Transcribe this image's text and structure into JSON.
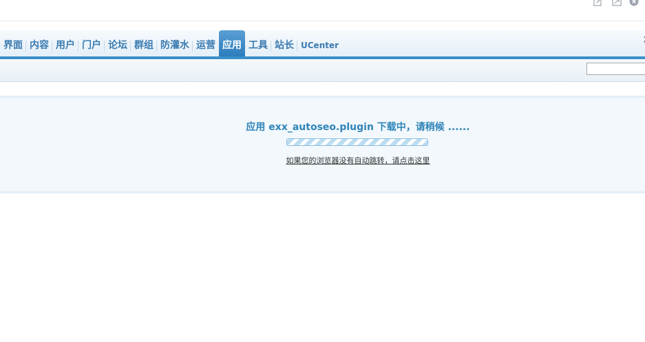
{
  "window_icons": [
    "edit-icon",
    "maximize-icon",
    "close-icon"
  ],
  "nav": {
    "items": [
      "界面",
      "内容",
      "用户",
      "门户",
      "论坛",
      "群组",
      "防灌水",
      "运营",
      "应用",
      "工具",
      "站长",
      "UCenter"
    ],
    "active": "应用",
    "user_text": "您"
  },
  "message": {
    "title": "应用 exx_autoseo.plugin 下载中，请稍候 ......",
    "redirect_link": "如果您的浏览器没有自动跳转，请点击这里"
  },
  "colors": {
    "accent": "#3a8fc7",
    "title": "#2f84b8",
    "nav_text": "#3b7bb0"
  }
}
